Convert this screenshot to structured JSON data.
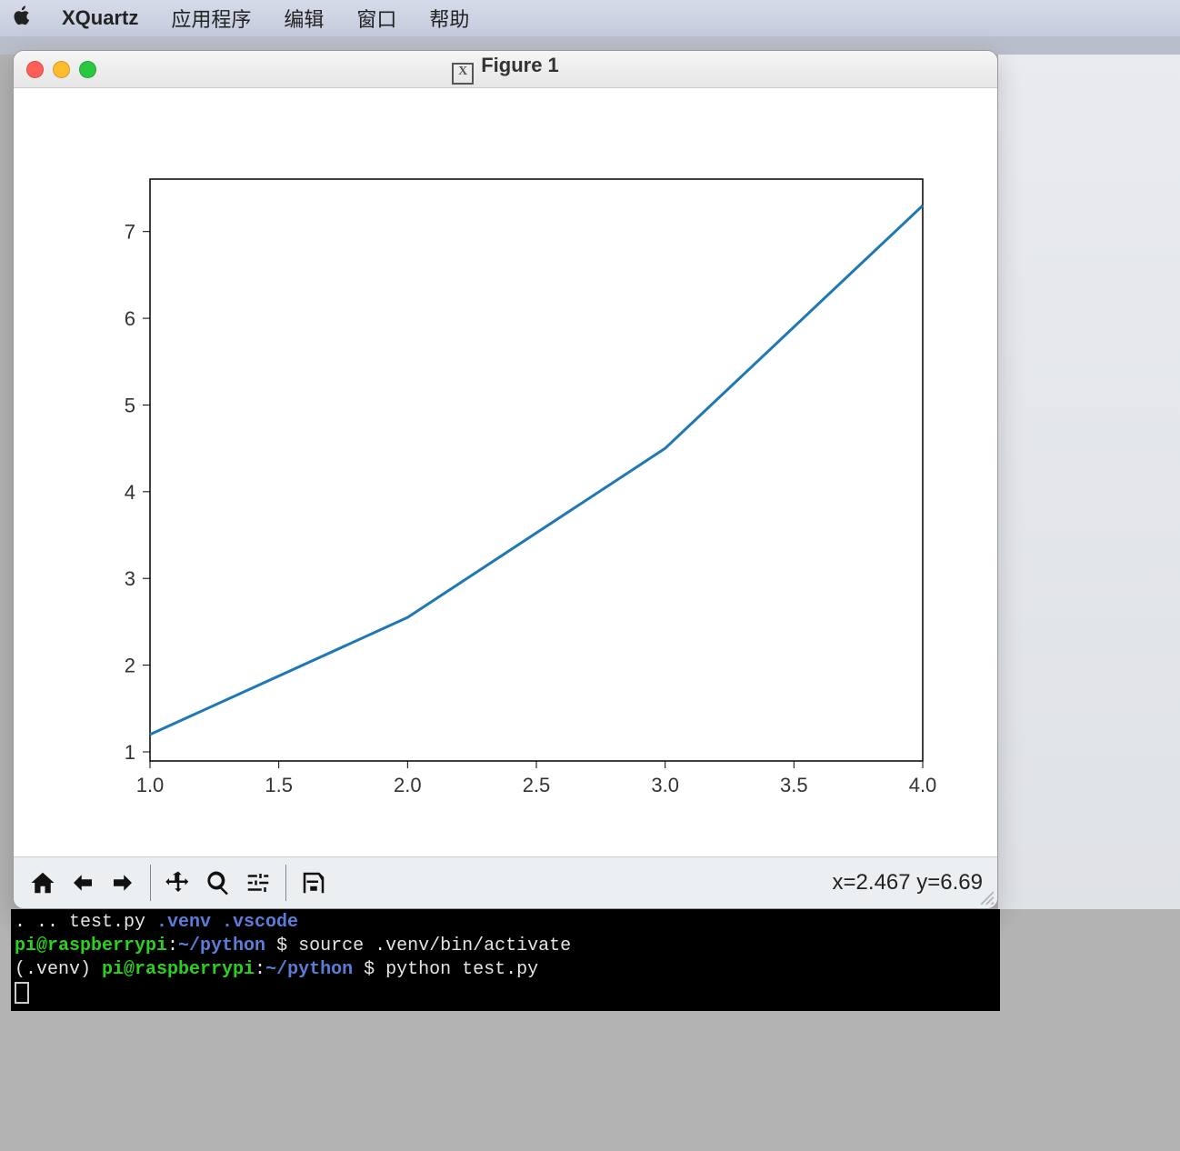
{
  "menubar": {
    "app": "XQuartz",
    "items": [
      "应用程序",
      "编辑",
      "窗口",
      "帮助"
    ]
  },
  "window": {
    "title": "Figure 1"
  },
  "toolbar": {
    "home": "Home",
    "back": "Back",
    "forward": "Forward",
    "pan": "Pan",
    "zoom": "Zoom",
    "configure": "Configure subplots",
    "save": "Save",
    "coord": "x=2.467 y=6.69"
  },
  "terminal": {
    "line1_pre": ".  ..  test.py  ",
    "line1_dirs": ".venv  .vscode",
    "line2_userhost": "pi@raspberrypi",
    "line2_path": "~/python",
    "line2_cmd": "source .venv/bin/activate",
    "line3_prefix": "(.venv) ",
    "line3_userhost": "pi@raspberrypi",
    "line3_path": "~/python",
    "line3_cmd": "python test.py"
  },
  "chart_data": {
    "type": "line",
    "x": [
      1,
      2,
      3,
      4
    ],
    "y": [
      1.2,
      2.55,
      4.5,
      7.3
    ],
    "xlim": [
      1.0,
      4.0
    ],
    "ylim": [
      1,
      7
    ],
    "xticks": [
      1.0,
      1.5,
      2.0,
      2.5,
      3.0,
      3.5,
      4.0
    ],
    "yticks": [
      1,
      2,
      3,
      4,
      5,
      6,
      7
    ],
    "line_color": "#1f77b4",
    "title": "",
    "xlabel": "",
    "ylabel": ""
  }
}
